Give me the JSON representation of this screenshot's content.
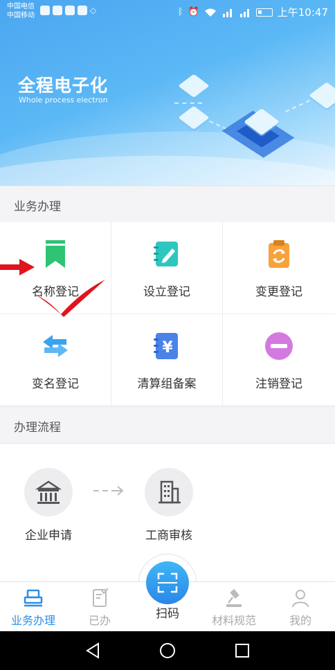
{
  "status_bar": {
    "carrier_1": "中国电信",
    "carrier_2": "中国移动",
    "time": "上午10:47",
    "icons": [
      "bluetooth-icon",
      "alarm-icon",
      "wifi-icon",
      "signal-4g-icon",
      "signal-2g-icon",
      "battery-icon"
    ]
  },
  "banner": {
    "title": "全程电子化",
    "subtitle": "Whole process electron"
  },
  "services": {
    "header": "业务办理",
    "items": [
      {
        "label": "名称登记",
        "icon": "bookmark-icon",
        "color": "#2fc474"
      },
      {
        "label": "设立登记",
        "icon": "notebook-pen-icon",
        "color": "#2ec7c0"
      },
      {
        "label": "变更登记",
        "icon": "clipboard-refresh-icon",
        "color": "#f7a23b"
      },
      {
        "label": "变名登记",
        "icon": "swap-arrows-icon",
        "color": "#3aa2ee"
      },
      {
        "label": "清算组备案",
        "icon": "yuan-ledger-icon",
        "color": "#4a82e8"
      },
      {
        "label": "注销登记",
        "icon": "minus-circle-icon",
        "color": "#d479e0"
      }
    ]
  },
  "process": {
    "header": "办理流程",
    "steps": [
      {
        "label": "企业申请",
        "icon": "bank-building-icon"
      },
      {
        "label": "工商审核",
        "icon": "office-building-icon"
      }
    ]
  },
  "tabbar": {
    "items": [
      {
        "label": "业务办理",
        "icon": "printer-desk-icon",
        "active": true
      },
      {
        "label": "已办",
        "icon": "document-check-icon",
        "active": false
      },
      {
        "label": "材料规范",
        "icon": "gavel-icon",
        "active": false
      },
      {
        "label": "我的",
        "icon": "person-icon",
        "active": false
      }
    ],
    "scan_label": "扫码"
  },
  "colors": {
    "accent": "#2a8fe8",
    "annotation": "#e0141e"
  }
}
